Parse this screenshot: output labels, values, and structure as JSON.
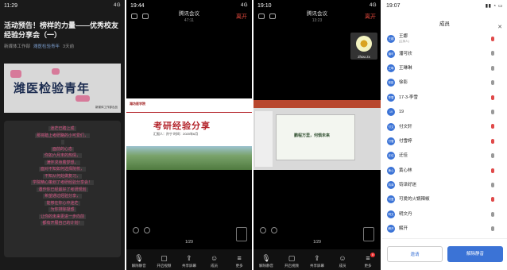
{
  "panel1": {
    "time": "11:29",
    "signal": "4G",
    "title": "活动预告！榜样的力量——优秀校友经验分享会（一）",
    "source": "新媒体工作部",
    "account": "潍医检验青年",
    "age": "3天前",
    "banner_title": "潍医检验青年",
    "banner_sub": "新媒体工作部出品",
    "poem": [
      "迷茫已踏上成",
      "那将踏上考研路的小可爱们，",
      "",
      "面前的心态",
      "你如六月末的热情，",
      "满怀求身着梦想，",
      "面对不知如何选择院校，",
      "不知从何处做复习，",
      "学院精心策划了考研经验分享会！",
      "邀作你已经最好了考研规划",
      "希望通过经验分享，",
      "能够在你心中迷茫",
      "为你排除疑惑",
      "让你的未来更进一步向前",
      "都有开展自己的计划！"
    ]
  },
  "panel2": {
    "time": "19:44",
    "signal": "4G",
    "app": "腾讯会议",
    "duration": "47:11",
    "leave": "离开",
    "slide_logo": "潍坊医学院",
    "slide_title": "考研经验分享",
    "slide_sub": "汇报人：孙宁    时间：2020年6月",
    "page": "1/29"
  },
  "panel3": {
    "time": "19:10",
    "signal": "4G",
    "app": "腾讯会议",
    "duration": "13:23",
    "leave": "离开",
    "slide_text": "鹏程万里，何惧未来",
    "tile_name": "zhou zx",
    "page": "1/29"
  },
  "toolbar": {
    "unmute": "解除静音",
    "video": "开启视频",
    "share": "共享屏幕",
    "members": "成员",
    "more": "更多",
    "badge": "8"
  },
  "panel4": {
    "time": "19:07",
    "title": "成员",
    "close": "✕",
    "host_role": "(主持人)",
    "members": [
      {
        "name": "王娜",
        "avatar": "王娜",
        "mic": "red"
      },
      {
        "name": "潘可欣",
        "avatar": "潘可",
        "mic": "gray"
      },
      {
        "name": "王琳琳",
        "avatar": "王琳",
        "mic": "gray"
      },
      {
        "name": "徐影",
        "avatar": "徐影",
        "mic": "gray"
      },
      {
        "name": "17-3-李雪",
        "avatar": "李雪",
        "mic": "red"
      },
      {
        "name": "19",
        "avatar": "19",
        "mic": "gray"
      },
      {
        "name": "付文轩",
        "avatar": "付文",
        "mic": "red"
      },
      {
        "name": "付雪婷",
        "avatar": "付雪",
        "mic": "red"
      },
      {
        "name": "迂佳",
        "avatar": "迂佳",
        "mic": "gray"
      },
      {
        "name": "黄心林",
        "avatar": "黄心",
        "mic": "red"
      },
      {
        "name": "钧泽好迷",
        "avatar": "钧泽",
        "mic": "gray"
      },
      {
        "name": "可爱的火锅辣椒",
        "avatar": "可爱",
        "mic": "red"
      },
      {
        "name": "明文丹",
        "avatar": "明文",
        "mic": "gray"
      },
      {
        "name": "解开",
        "avatar": "解开",
        "mic": "gray"
      }
    ],
    "invite": "邀请",
    "mute_all": "解除静音"
  }
}
